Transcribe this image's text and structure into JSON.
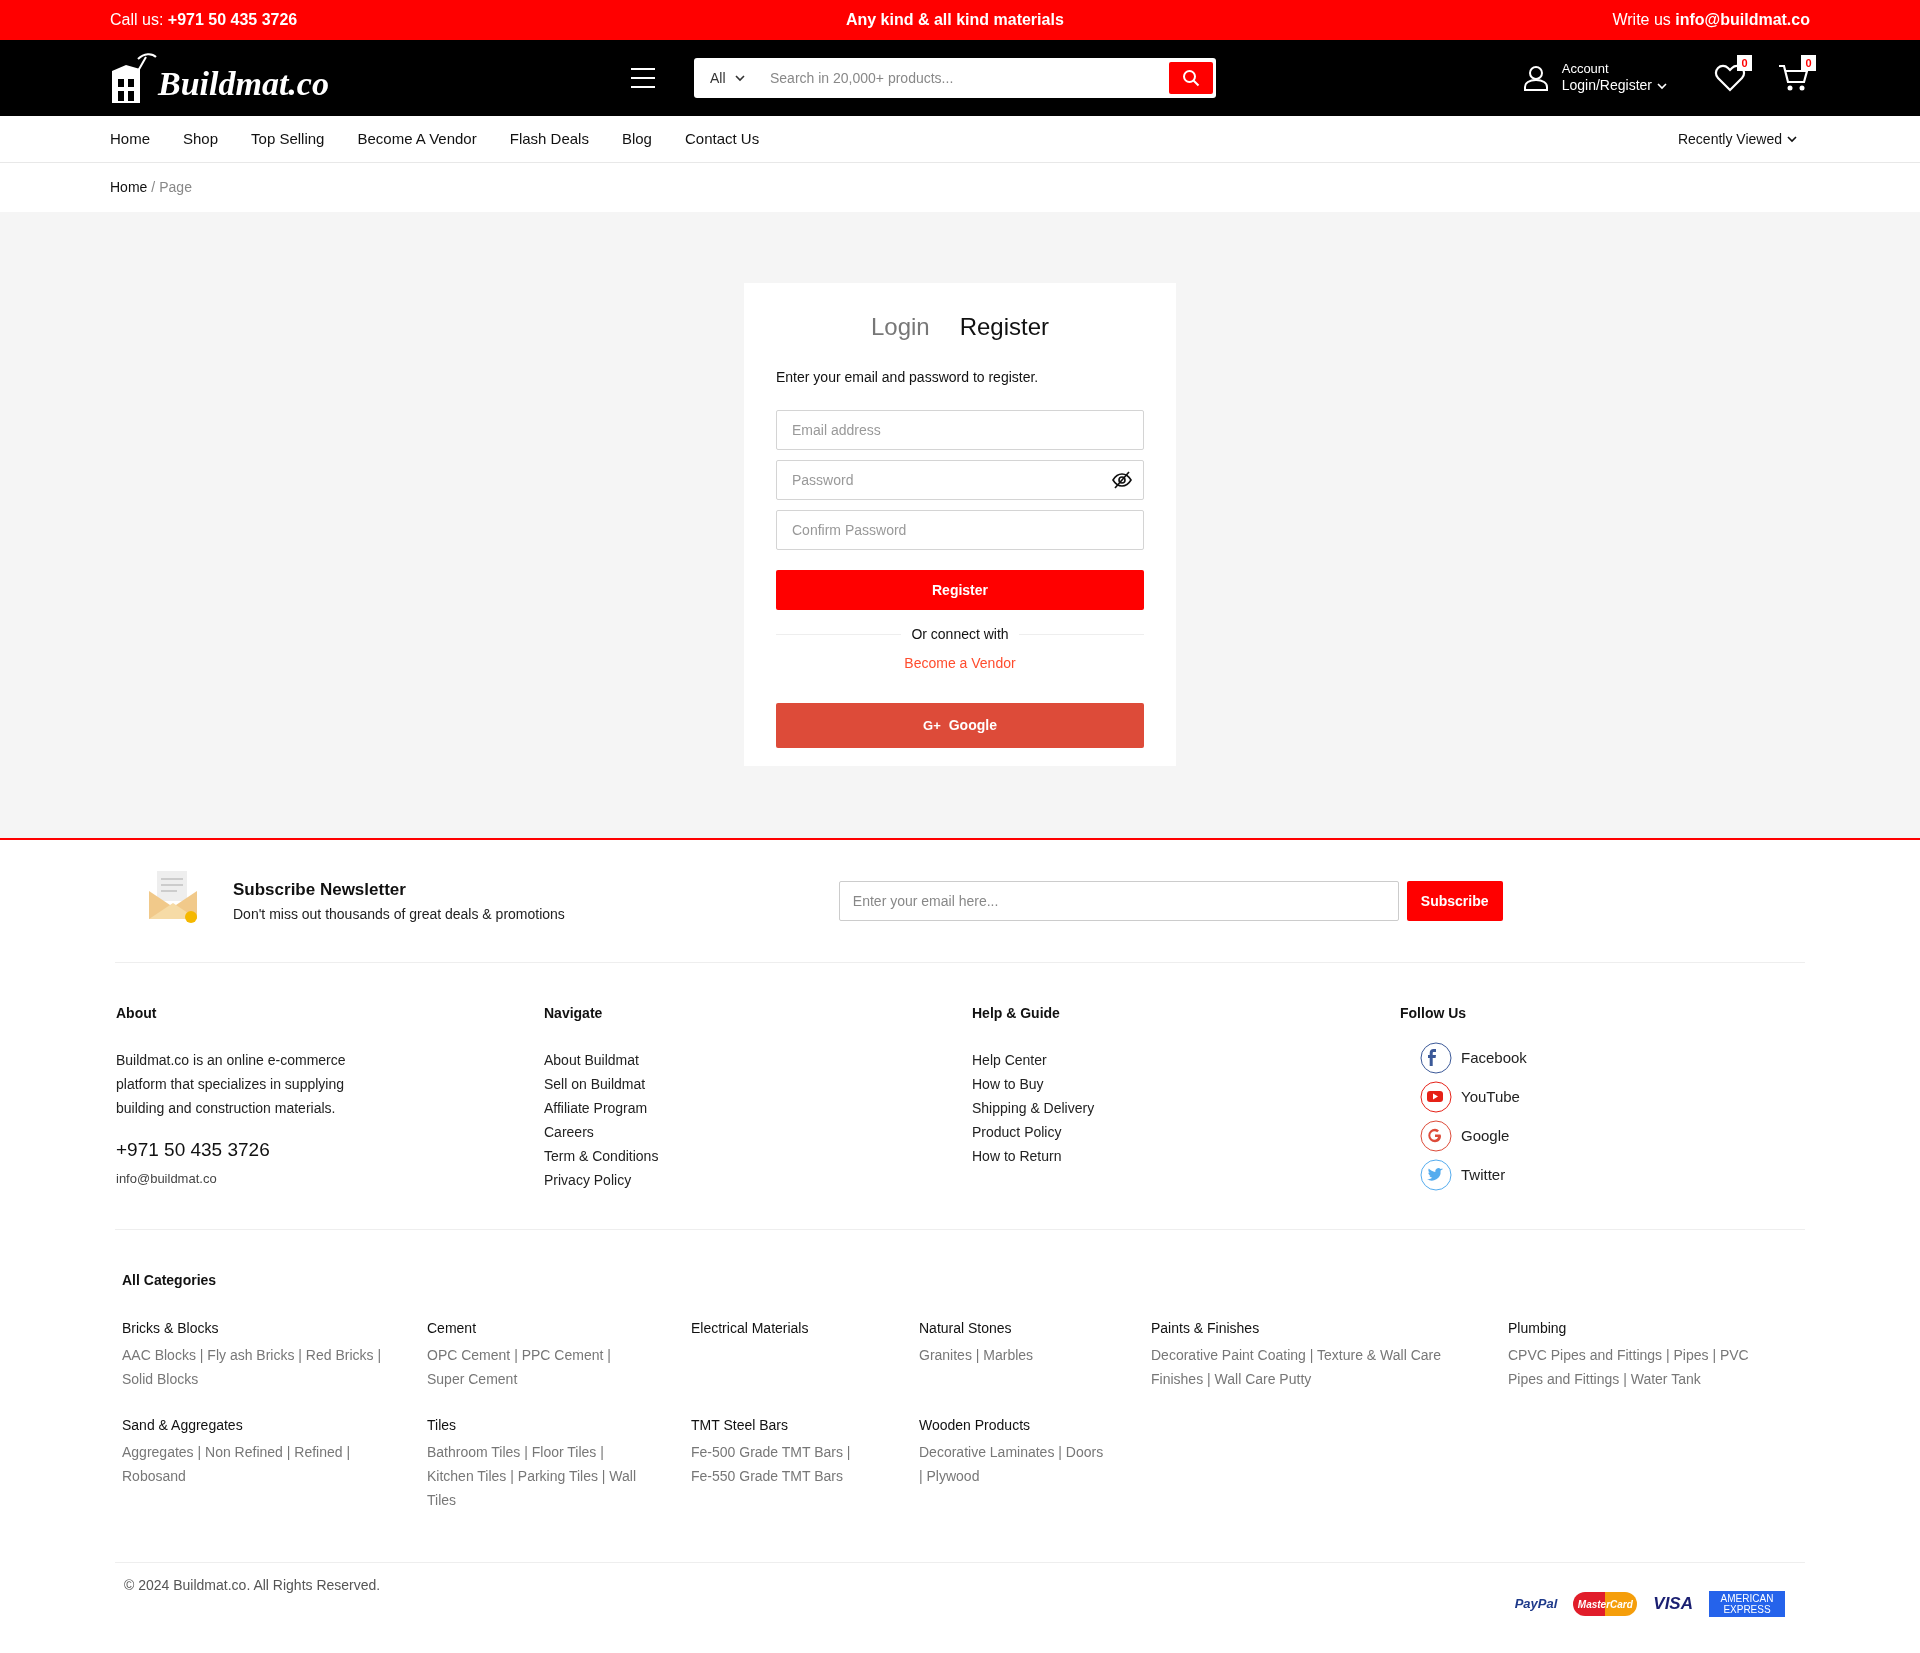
{
  "top_bar": {
    "phone_label": "Call us:",
    "phone": "+971 50 435 3726",
    "tagline": "Any kind & all kind materials",
    "email_label": "Write us",
    "email": "info@buildmat.co"
  },
  "header": {
    "logo": "Buildmat.co",
    "search": {
      "category": "All",
      "placeholder": "Search in 20,000+ products..."
    },
    "account": {
      "label": "Account",
      "link": "Login/Register"
    },
    "wishlist_count": "0",
    "cart_count": "0"
  },
  "nav": {
    "items": [
      "Home",
      "Shop",
      "Top Selling",
      "Become A Vendor",
      "Flash Deals",
      "Blog",
      "Contact Us"
    ],
    "recently_viewed": "Recently Viewed"
  },
  "breadcrumb": {
    "home": "Home",
    "separator": "/",
    "current": "Page"
  },
  "auth": {
    "tabs": [
      {
        "label": "Login",
        "selected": false
      },
      {
        "label": "Register",
        "selected": true
      }
    ],
    "intro": "Enter your email and password to register.",
    "fields": [
      {
        "placeholder": "Email address",
        "kind": "text"
      },
      {
        "placeholder": "Password",
        "kind": "password"
      },
      {
        "placeholder": "Confirm Password",
        "kind": "text"
      }
    ],
    "submit": "Register",
    "divider": "Or connect with",
    "vendor_link": "Become a Vendor",
    "google": {
      "icon": "G+",
      "label": "Google"
    }
  },
  "newsletter": {
    "title": "Subscribe Newsletter",
    "subtitle": "Don't miss out thousands of great deals & promotions",
    "placeholder": "Enter your email here...",
    "button": "Subscribe"
  },
  "footer": {
    "about": {
      "title": "About",
      "text": "Buildmat.co is an online e-commerce platform that specializes in supplying building and construction materials.",
      "phone": "+971 50 435 3726",
      "email": "info@buildmat.co"
    },
    "navigate": {
      "title": "Navigate",
      "links": [
        "About Buildmat",
        "Sell on Buildmat",
        "Affiliate Program",
        "Careers",
        "Term & Conditions",
        "Privacy Policy"
      ]
    },
    "help": {
      "title": "Help & Guide",
      "links": [
        "Help Center",
        "How to Buy",
        "Shipping & Delivery",
        "Product Policy",
        "How to Return"
      ]
    },
    "follow": {
      "title": "Follow Us",
      "links": [
        {
          "label": "Facebook",
          "kind": "facebook",
          "color": "#3b5998"
        },
        {
          "label": "YouTube",
          "kind": "youtube",
          "color": "#e62117"
        },
        {
          "label": "Google",
          "kind": "google",
          "color": "#dd4b39"
        },
        {
          "label": "Twitter",
          "kind": "twitter",
          "color": "#55acee"
        }
      ]
    }
  },
  "categories": {
    "title": "All Categories",
    "items": [
      {
        "name": "Bricks & Blocks",
        "links": "AAC Blocks | Fly ash Bricks | Red Bricks | Solid Blocks"
      },
      {
        "name": "Cement",
        "links": "OPC Cement | PPC Cement | Super Cement"
      },
      {
        "name": "Electrical Materials"
      },
      {
        "name": "Natural Stones",
        "links": "Granites | Marbles"
      },
      {
        "name": "Paints & Finishes",
        "links": "Decorative Paint Coating | Texture & Wall Care Finishes | Wall Care Putty"
      },
      {
        "name": "Plumbing",
        "links": "CPVC Pipes and Fittings | Pipes | PVC Pipes and Fittings | Water Tank"
      },
      {
        "name": "Sand & Aggregates",
        "links": "Aggregates | Non Refined | Refined | Robosand"
      },
      {
        "name": "Tiles",
        "links": "Bathroom Tiles | Floor Tiles | Kitchen Tiles | Parking Tiles | Wall Tiles"
      },
      {
        "name": "TMT Steel Bars",
        "links": "Fe-500 Grade TMT Bars | Fe-550 Grade TMT Bars"
      },
      {
        "name": "Wooden Products",
        "links": "Decorative Laminates | Doors | Plywood"
      }
    ]
  },
  "copyright": "© 2024 Buildmat.co. All Rights Reserved.",
  "payments": [
    {
      "kind": "paypal",
      "label": "PayPal"
    },
    {
      "kind": "mastercard",
      "label": "MasterCard"
    },
    {
      "kind": "visa",
      "label": "VISA"
    },
    {
      "kind": "amex",
      "label": "AMERICAN EXPRESS"
    }
  ]
}
